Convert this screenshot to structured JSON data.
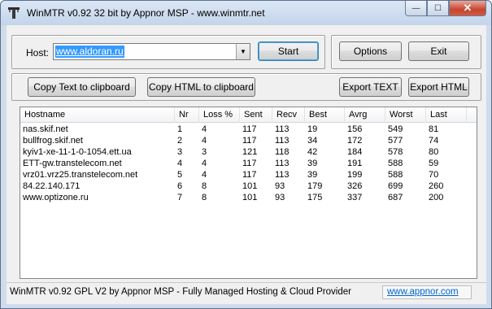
{
  "window": {
    "title": "WinMTR v0.92 32 bit by Appnor MSP - www.winmtr.net",
    "minimize_glyph": "—",
    "maximize_glyph": "☐",
    "close_glyph": "✕"
  },
  "host": {
    "label": "Host:",
    "value": "www.aldoran.ru",
    "dropdown_glyph": "▼"
  },
  "buttons": {
    "start": "Start",
    "options": "Options",
    "exit": "Exit",
    "copy_text": "Copy Text to clipboard",
    "copy_html": "Copy HTML to clipboard",
    "export_text": "Export TEXT",
    "export_html": "Export HTML"
  },
  "table": {
    "columns": [
      "Hostname",
      "Nr",
      "Loss %",
      "Sent",
      "Recv",
      "Best",
      "Avrg",
      "Worst",
      "Last"
    ],
    "rows": [
      [
        "nas.skif.net",
        "1",
        "4",
        "117",
        "113",
        "19",
        "156",
        "549",
        "81"
      ],
      [
        "bullfrog.skif.net",
        "2",
        "4",
        "117",
        "113",
        "34",
        "172",
        "577",
        "74"
      ],
      [
        "kyiv1-xe-11-1-0-1054.ett.ua",
        "3",
        "3",
        "121",
        "118",
        "42",
        "184",
        "578",
        "80"
      ],
      [
        "ETT-gw.transtelecom.net",
        "4",
        "4",
        "117",
        "113",
        "39",
        "191",
        "588",
        "59"
      ],
      [
        "vrz01.vrz25.transtelecom.net",
        "5",
        "4",
        "117",
        "113",
        "39",
        "199",
        "588",
        "70"
      ],
      [
        "84.22.140.171",
        "6",
        "8",
        "101",
        "93",
        "179",
        "326",
        "699",
        "260"
      ],
      [
        "www.optizone.ru",
        "7",
        "8",
        "101",
        "93",
        "175",
        "337",
        "687",
        "200"
      ]
    ]
  },
  "status": {
    "text": "WinMTR v0.92 GPL V2 by Appnor MSP - Fully Managed Hosting & Cloud Provider",
    "link": "www.appnor.com"
  }
}
